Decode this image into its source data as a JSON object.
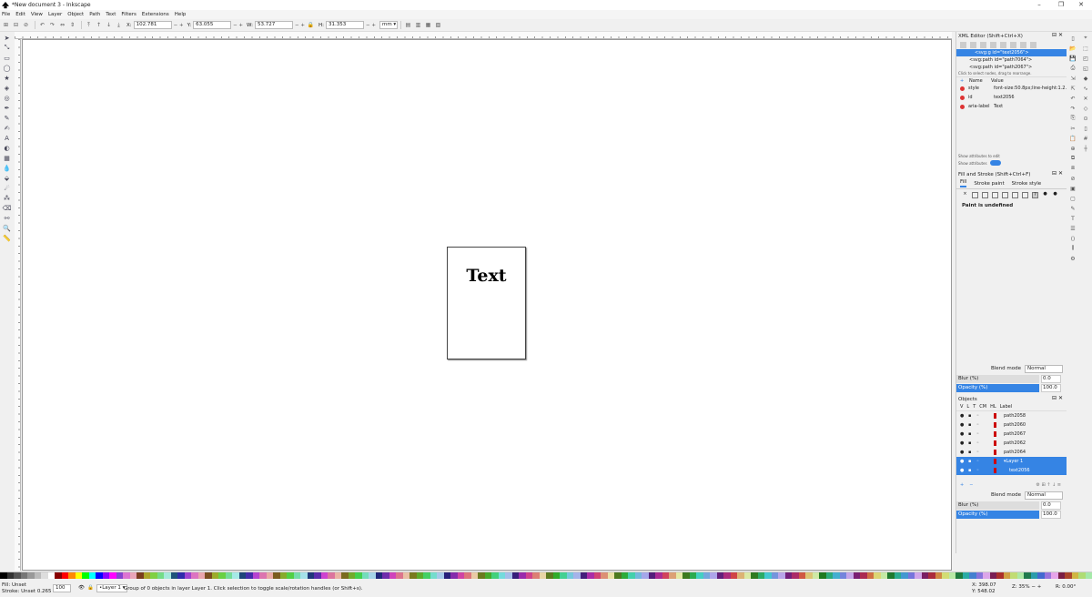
{
  "window": {
    "title": "*New document 3 - Inkscape",
    "min": "–",
    "max": "❐",
    "close": "✕"
  },
  "menu": [
    "File",
    "Edit",
    "View",
    "Layer",
    "Object",
    "Path",
    "Text",
    "Filters",
    "Extensions",
    "Help"
  ],
  "tool_controls": {
    "x_label": "X:",
    "x": "102.781",
    "y_label": "Y:",
    "y": "63.055",
    "w_label": "W:",
    "w": "53.727",
    "h_label": "H:",
    "h": "31.353",
    "unit": "mm ▾"
  },
  "canvas": {
    "text": "Text"
  },
  "xml_editor": {
    "title": "XML Editor (Shift+Ctrl+X)",
    "nodes": [
      "<svg:g id=\"text2056\">",
      "<svg:path id=\"path7064\">",
      "<svg:path id=\"path2067\">"
    ],
    "hint": "Click to select nodes, drag to rearrange.",
    "col_name": "Name",
    "col_value": "Value",
    "attrs": [
      {
        "k": "style",
        "v": "font-size:50.8px;line-height:1.2..."
      },
      {
        "k": "id",
        "v": "text2056"
      },
      {
        "k": "aria-label",
        "v": "Text"
      }
    ],
    "edit_hint": "Show attributes to edit",
    "show_attrs": "Show attributes"
  },
  "fill_stroke": {
    "title": "Fill and Stroke (Shift+Ctrl+F)",
    "tabs": [
      "Fill",
      "Stroke paint",
      "Stroke style"
    ],
    "undefined": "Paint is undefined",
    "blend_label": "Blend mode",
    "blend_value": "Normal",
    "blur_label": "Blur (%)",
    "blur_value": "0.0",
    "opacity_label": "Opacity (%)",
    "opacity_value": "100.0"
  },
  "objects": {
    "title": "Objects",
    "cols": [
      "V",
      "L",
      "T",
      "CM",
      "HL",
      "Label"
    ],
    "rows": [
      "path2058",
      "path2060",
      "path2067",
      "path2062",
      "path2064",
      "Layer 1",
      "text2056"
    ],
    "blend_label": "Blend mode",
    "blend_value": "Normal",
    "blur_label": "Blur (%)",
    "blur_value": "0.0",
    "opacity_label": "Opacity (%)",
    "opacity_value": "100.0"
  },
  "status": {
    "fill_label": "Fill:",
    "fill": "Unset",
    "stroke_label": "Stroke:",
    "stroke": "Unset",
    "stroke_width": "0.265",
    "opacity": "100",
    "layer": "•Layer 1 ▾",
    "message": "Group of 0 objects in layer Layer 1. Click selection to toggle scale/rotation handles (or Shift+s).",
    "x_label": "X:",
    "x": "398.07",
    "y_label": "Y:",
    "y": "548.02",
    "zoom_label": "Z:",
    "zoom": "35%",
    "rot_label": "R:",
    "rotation": "0.00°"
  }
}
